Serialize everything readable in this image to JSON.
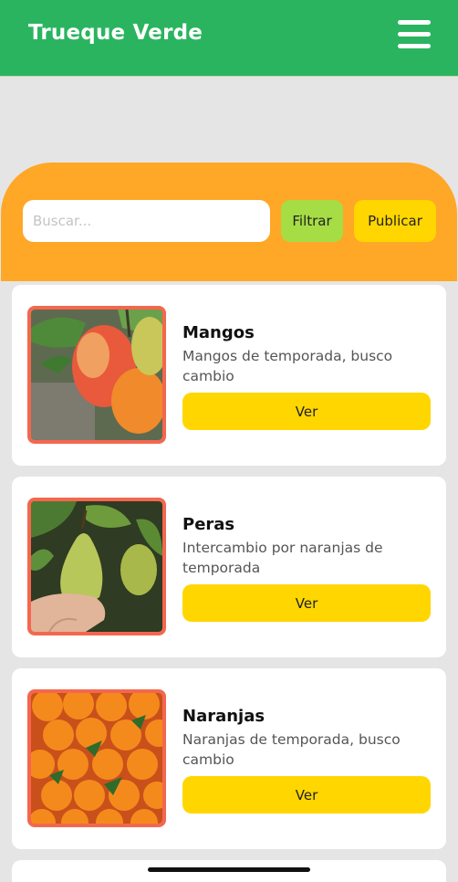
{
  "app": {
    "title": "Trueque Verde",
    "menu_icon": "hamburger-menu-icon"
  },
  "toolbar": {
    "search_placeholder": "Buscar...",
    "search_value": "",
    "filter_label": "Filtrar",
    "publish_label": "Publicar"
  },
  "listings": [
    {
      "title": "Mangos",
      "description": "Mangos de temporada, busco cambio",
      "button_label": "Ver",
      "image": "mangos-photo"
    },
    {
      "title": "Peras",
      "description": "Intercambio por naranjas de temporada",
      "button_label": "Ver",
      "image": "pears-photo"
    },
    {
      "title": "Naranjas",
      "description": "Naranjas de temporada, busco cambio",
      "button_label": "Ver",
      "image": "oranges-photo"
    }
  ],
  "colors": {
    "header_green": "#2ab45f",
    "panel_orange": "#ffa726",
    "filter_green": "#a6dd45",
    "button_yellow": "#ffd600",
    "image_border": "#f4674e"
  }
}
